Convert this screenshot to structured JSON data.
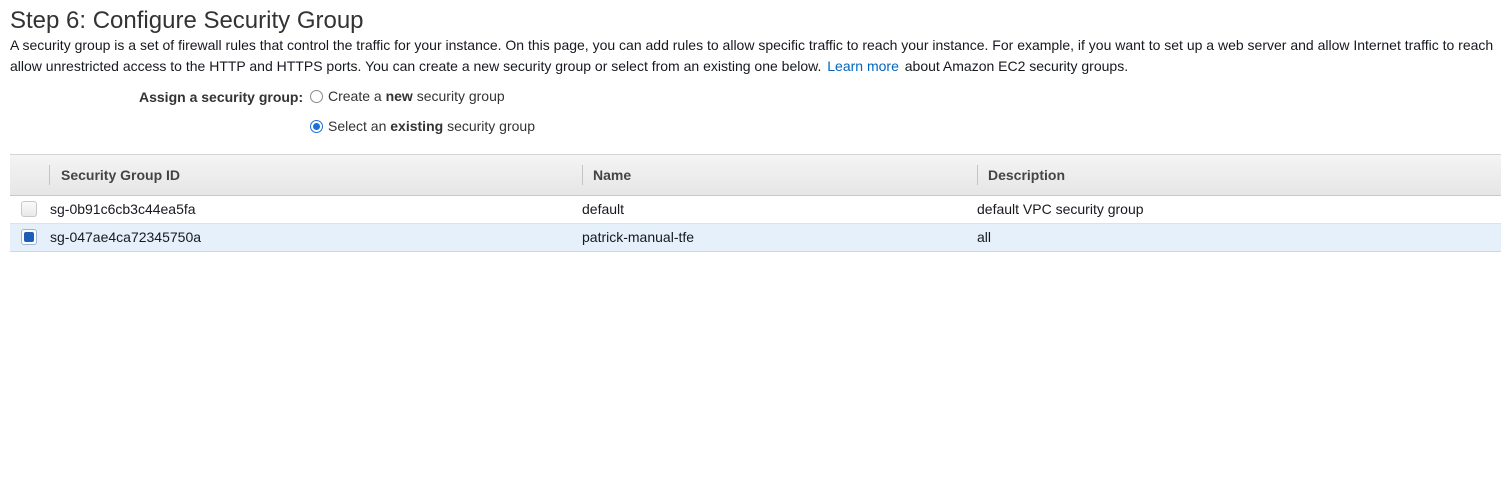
{
  "page": {
    "title": "Step 6: Configure Security Group",
    "intro_line1": "A security group is a set of firewall rules that control the traffic for your instance. On this page, you can add rules to allow specific traffic to reach your instance. For example, if you want to set up a web server and allow Internet traffic to reach",
    "intro_line2_before": "allow unrestricted access to the HTTP and HTTPS ports. You can create a new security group or select from an existing one below.",
    "learn_more_link": "Learn more",
    "intro_line2_after": "about Amazon EC2 security groups."
  },
  "assign": {
    "label": "Assign a security group:",
    "options": [
      {
        "prefix": "Create a",
        "emphasis": "new",
        "suffix": "security group",
        "selected": false
      },
      {
        "prefix": "Select an",
        "emphasis": "existing",
        "suffix": "security group",
        "selected": true
      }
    ]
  },
  "table": {
    "headers": {
      "id": "Security Group ID",
      "name": "Name",
      "description": "Description"
    },
    "rows": [
      {
        "id": "sg-0b91c6cb3c44ea5fa",
        "name": "default",
        "description": "default VPC security group",
        "checked": false
      },
      {
        "id": "sg-047ae4ca72345750a",
        "name": "patrick-manual-tfe",
        "description": "all",
        "checked": true
      }
    ]
  },
  "colors": {
    "link": "#0066c0",
    "accent": "#1a5fb4",
    "selected_row": "#e6f0fb"
  }
}
